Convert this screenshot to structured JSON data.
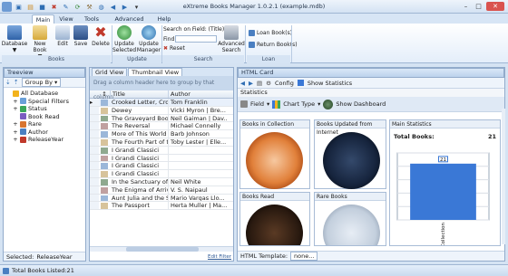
{
  "app": {
    "title": "eXtreme Books Manager 1.0.2.1 (example.mdb)"
  },
  "ribbon": {
    "tabs": [
      "Main",
      "View",
      "Tools",
      "Advanced Tools",
      "Help"
    ],
    "active_tab": "Main",
    "groups": {
      "books": {
        "label": "Books",
        "buttons": [
          "Database",
          "New Book",
          "Edit",
          "Save",
          "Delete"
        ]
      },
      "update": {
        "label": "Update",
        "buttons": [
          "Update Selected",
          "Update Manager"
        ]
      },
      "search": {
        "label": "Search",
        "field_label": "Search on Field: (Title)",
        "find_label": "Find",
        "reset_label": "Reset",
        "adv_label": "Advanced Search"
      },
      "loan": {
        "label": "Loan",
        "loan_label": "Loan Book(s)",
        "return_label": "Return Book(s)"
      }
    },
    "database_arrow": "▼",
    "newbook_arrow": "▼",
    "search_arrow": "▼"
  },
  "treeview": {
    "title": "Treeview",
    "group_by": "Group By",
    "items": [
      {
        "label": "All Database",
        "indent": 0,
        "expander": ""
      },
      {
        "label": "Special Filters",
        "indent": 1,
        "expander": "+"
      },
      {
        "label": "Status",
        "indent": 1,
        "expander": "+"
      },
      {
        "label": "Book Read",
        "indent": 1,
        "expander": ""
      },
      {
        "label": "Rare",
        "indent": 1,
        "expander": "+"
      },
      {
        "label": "Author",
        "indent": 1,
        "expander": "+"
      },
      {
        "label": "ReleaseYear",
        "indent": 1,
        "expander": "+"
      }
    ],
    "selected_label": "Selected:",
    "selected_value": "ReleaseYear"
  },
  "grid": {
    "tabs": [
      "Grid View",
      "Thumbnail View"
    ],
    "group_hint": "Drag a column header here to group by that column",
    "columns": [
      "Title",
      "Author"
    ],
    "rows": [
      {
        "title": "Crooked Letter, Cro...",
        "author": "Tom Franklin"
      },
      {
        "title": "Dewey",
        "author": "Vicki Myron | Bre..."
      },
      {
        "title": "The Graveyard Book",
        "author": "Neil Gaiman | Dav..."
      },
      {
        "title": "The Reversal",
        "author": "Michael Connelly"
      },
      {
        "title": "More of This World ...",
        "author": "Barb Johnson"
      },
      {
        "title": "The Fourth Part of t...",
        "author": "Toby Lester | Elle..."
      },
      {
        "title": "I Grandi Classici",
        "author": ""
      },
      {
        "title": "I Grandi Classici",
        "author": ""
      },
      {
        "title": "I Grandi Classici",
        "author": ""
      },
      {
        "title": "I Grandi Classici",
        "author": ""
      },
      {
        "title": "In the Sanctuary of ...",
        "author": "Neil White"
      },
      {
        "title": "The Enigma of Arrival",
        "author": "V. S. Naipaul"
      },
      {
        "title": "Aunt Julia and the S...",
        "author": "Mario Vargas Llo..."
      },
      {
        "title": "The Passport",
        "author": "Herta Muller | Ma..."
      }
    ],
    "edit_filter": "Edit Filter"
  },
  "html_card": {
    "title": "HTML Card",
    "toolbar": {
      "config": "Config",
      "show_stats": "Show Statistics"
    },
    "statistics_label": "Statistics",
    "field_label": "Field",
    "chart_type_label": "Chart Type",
    "dashboard_label": "Show Dashboard",
    "cards": [
      "Books in Collection",
      "Books Updated from Internet",
      "Books Read",
      "Rare Books"
    ],
    "main_stats_title": "Main Statistics",
    "total_books_label": "Total Books:",
    "total_books_value": "21",
    "template_label": "HTML Template:",
    "template_value": "none..."
  },
  "status": {
    "total_books": "Total Books Listed:21"
  },
  "chart_data": {
    "type": "bar",
    "categories": [
      "In Collection"
    ],
    "values": [
      21
    ],
    "data_labels": [
      "21"
    ],
    "title": "",
    "xlabel": "",
    "ylabel": "",
    "ylim": [
      0,
      25
    ],
    "yticks": [
      0,
      5,
      10,
      15,
      20,
      25
    ],
    "grid": true,
    "colors": {
      "bar": "#3a78d6"
    }
  },
  "colors": {
    "accent": "#3a78d6",
    "panel": "#d5e3f3"
  }
}
